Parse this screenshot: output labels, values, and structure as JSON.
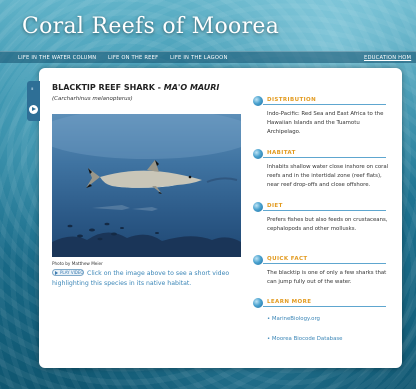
{
  "site": {
    "title": "Coral Reefs of Moorea"
  },
  "nav": {
    "items": [
      {
        "label": "LIFE IN THE WATER COLUMN"
      },
      {
        "label": "LIFE ON THE REEF"
      },
      {
        "label": "LIFE IN THE LAGOON"
      },
      {
        "label": "EDUCATION HOM"
      }
    ]
  },
  "species": {
    "common_name": "BLACKTIP REEF SHARK - ",
    "local_name": "MA'O MAURI",
    "scientific_name": "(Carcharhinus melanopterus)",
    "photo_credit": "Photo by Matthew Meier",
    "play_label": "PLAY VIDEO",
    "video_text": "Click on the image above to see a short video highlighting this species in its native habitat."
  },
  "sections": {
    "distribution": {
      "title": "DISTRIBUTION",
      "body": "Indo-Pacific: Red Sea and East Africa to the Hawaiian Islands and the Tuamotu Archipelago."
    },
    "habitat": {
      "title": "HABITAT",
      "body": "Inhabits shallow water close inshore on coral reefs and in the intertidal zone (reef flats), near reef drop-offs and close offshore."
    },
    "diet": {
      "title": "DIET",
      "body": "Prefers fishes but also feeds on crustaceans, cephalopods and other mollusks."
    },
    "quick_fact": {
      "title": "QUICK FACT",
      "body": "The blacktip is one of only a few sharks that can jump fully out of the water."
    },
    "learn_more": {
      "title": "LEARN MORE",
      "links": [
        {
          "label": "• MarineBiology.org"
        },
        {
          "label": "• Moorea Biocode Database"
        }
      ]
    }
  },
  "colors": {
    "accent_orange": "#e29a1e",
    "link_blue": "#3b86b7"
  }
}
